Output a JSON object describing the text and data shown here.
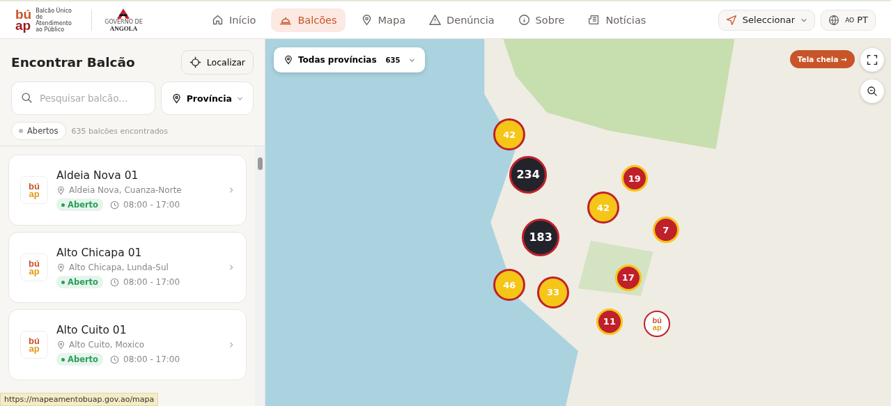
{
  "header": {
    "logo": {
      "top": "bú",
      "bottom": "ap",
      "tagline": "Balcão Único de Atendimento ao Público"
    },
    "partner_logo": {
      "line_1": "GOVERNO DE",
      "line_2": "ANGOLA"
    },
    "nav": [
      {
        "label": "Início",
        "selected": false
      },
      {
        "label": "Balcões",
        "selected": true
      },
      {
        "label": "Mapa",
        "selected": false
      },
      {
        "label": "Denúncia",
        "selected": false
      },
      {
        "label": "Sobre",
        "selected": false
      },
      {
        "label": "Notícias",
        "selected": false
      }
    ],
    "location_select": "Seleccionar",
    "language": {
      "region": "AO",
      "code": "PT"
    }
  },
  "sidebar": {
    "title": "Encontrar Balcão",
    "locate_button": "Localizar",
    "search": {
      "placeholder": "Pesquisar balcão..."
    },
    "province_select": "Província",
    "filter_chip": "Abertos",
    "result_count": "635 balcões encontrados",
    "items": [
      {
        "logo_top": "bú",
        "logo_bottom": "ap",
        "name": "Aldeia Nova 01",
        "location": "Aldeia Nova, Cuanza-Norte",
        "status": "Aberto",
        "open": true,
        "hours": "08:00 - 17:00"
      },
      {
        "logo_top": "bú",
        "logo_bottom": "ap",
        "name": "Alto Chicapa 01",
        "location": "Alto Chicapa, Lunda-Sul",
        "status": "Aberto",
        "open": true,
        "hours": "08:00 - 17:00"
      },
      {
        "logo_top": "bú",
        "logo_bottom": "ap",
        "name": "Alto Cuito 01",
        "location": "Alto Cuito, Moxico",
        "status": "Aberto",
        "open": true,
        "hours": "08:00 - 17:00"
      }
    ]
  },
  "map": {
    "province_filter": {
      "label": "Todas províncias",
      "count": "635"
    },
    "fullscreen_hint": "Tela cheia →",
    "clusters": [
      {
        "count": "42",
        "color": "#f5c518"
      },
      {
        "count": "234",
        "color": "#23232b"
      },
      {
        "count": "19",
        "color": "#c0202a"
      },
      {
        "count": "42",
        "color": "#f5c518"
      },
      {
        "count": "7",
        "color": "#c0202a"
      },
      {
        "count": "183",
        "color": "#23232b"
      },
      {
        "count": "17",
        "color": "#c0202a"
      },
      {
        "count": "46",
        "color": "#f5c518"
      },
      {
        "count": "33",
        "color": "#f5c518"
      },
      {
        "count": "11",
        "color": "#c0202a"
      }
    ],
    "office_marker": {
      "top": "bú",
      "bottom": "ap"
    }
  },
  "status_url": "https://mapeamentobuap.gov.ao/mapa"
}
